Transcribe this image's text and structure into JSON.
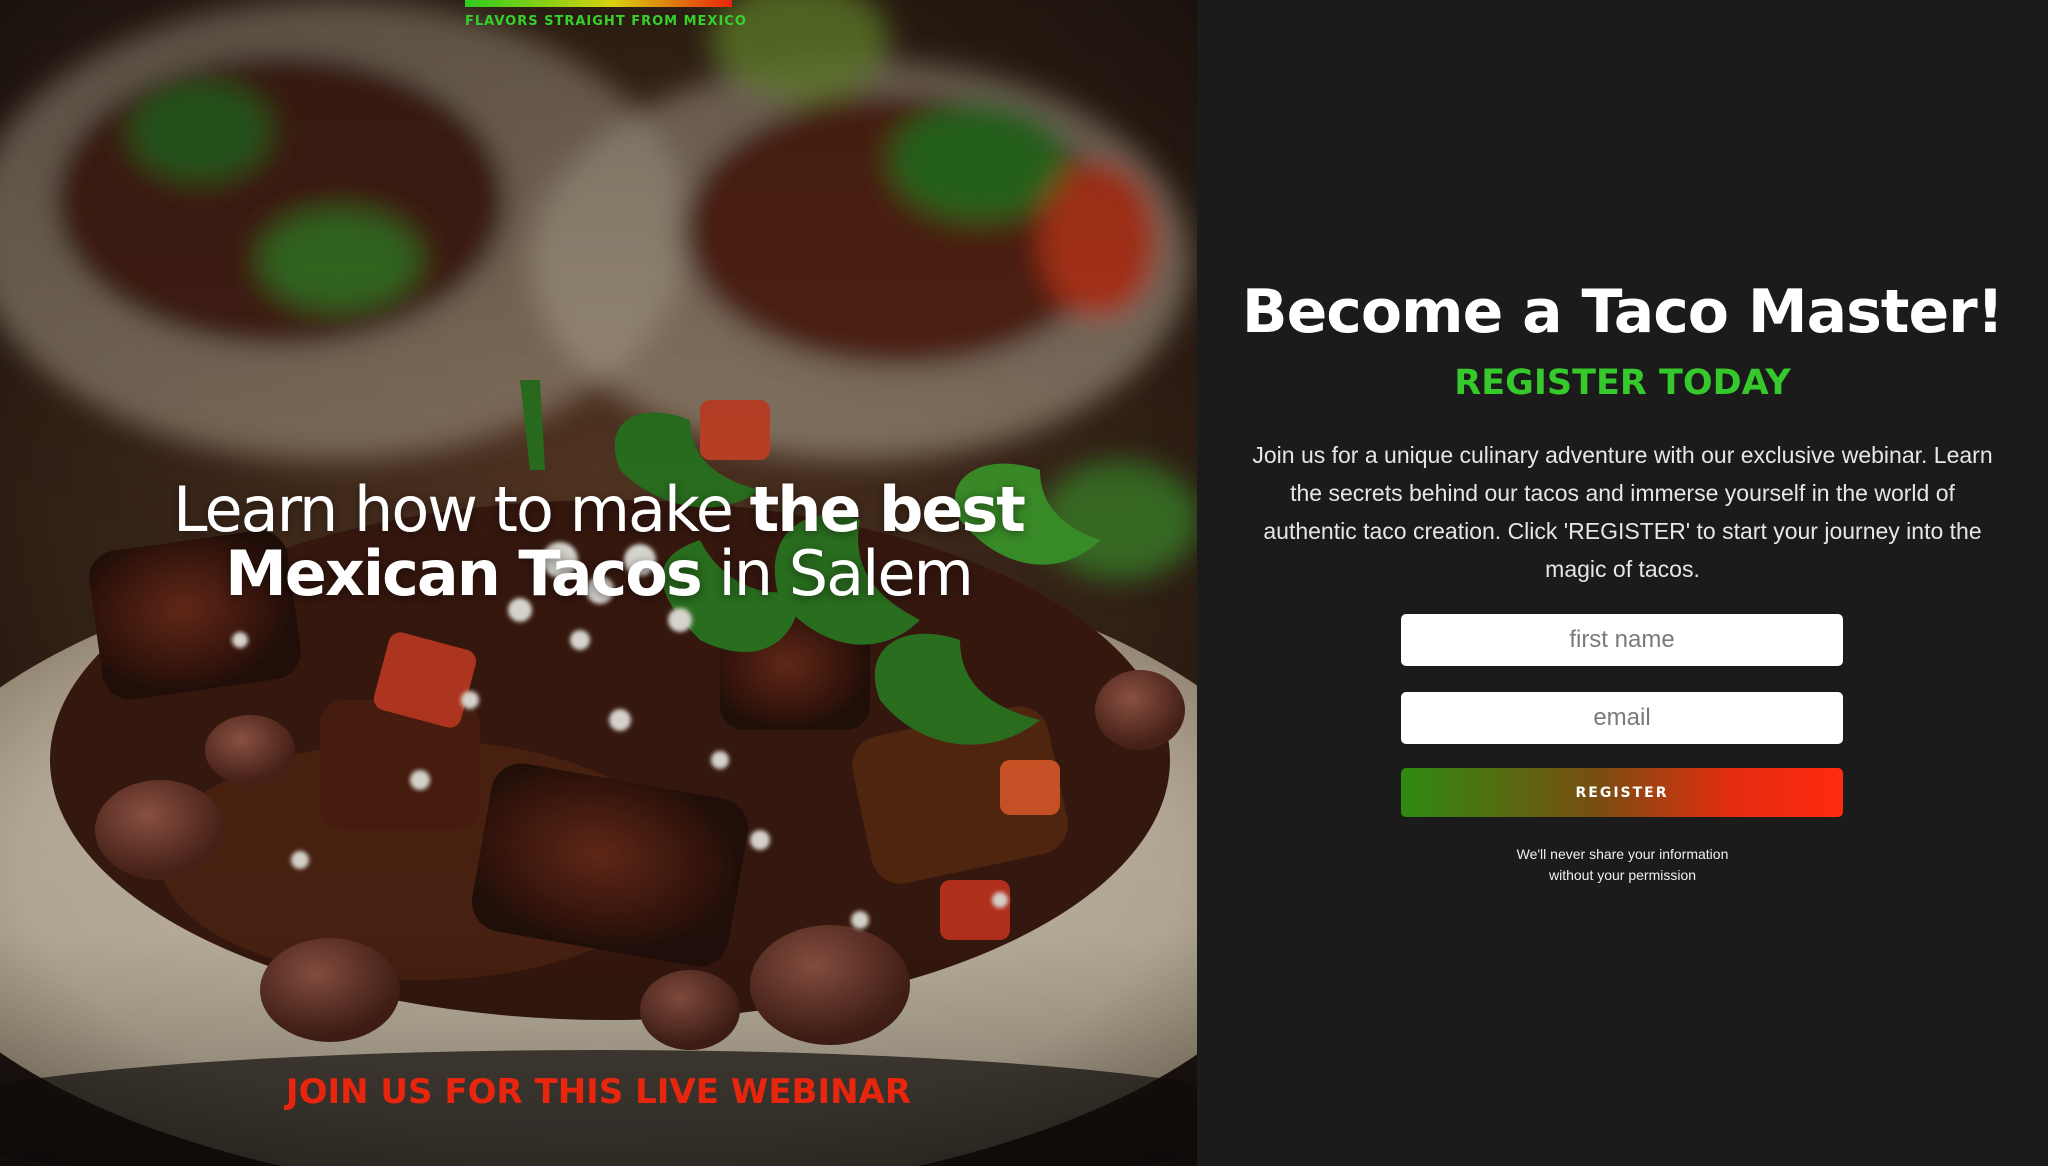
{
  "brand": {
    "tagline": "FLAVORS STRAIGHT FROM MEXICO",
    "bar_gradient": [
      "#2ecc1f",
      "#d7d20f",
      "#e8260e"
    ]
  },
  "hero": {
    "headline_line1_light": "Learn how to make ",
    "headline_line1_bold": "the best",
    "headline_line2_bold": "Mexican Tacos",
    "headline_line2_light": " in Salem",
    "footer": "JOIN US FOR THIS LIVE WEBINAR",
    "photo_icon": "taco-photo-image"
  },
  "panel": {
    "title": "Become a Taco Master!",
    "subtitle": "REGISTER TODAY",
    "description": "Join us for a unique culinary adventure with our exclusive webinar. Learn the secrets behind our tacos and immerse yourself in the world of authentic taco creation. Click 'REGISTER' to start your journey into the magic of tacos."
  },
  "form": {
    "first_name_placeholder": "first name",
    "first_name_value": "",
    "email_placeholder": "email",
    "email_value": "",
    "register_label": "REGISTER"
  },
  "privacy": {
    "line1": "We'll never share your information",
    "line2": "without your permission"
  },
  "colors": {
    "accent_green": "#36c92b",
    "accent_red": "#e8260e",
    "panel_bg": "#1b1b1b"
  }
}
